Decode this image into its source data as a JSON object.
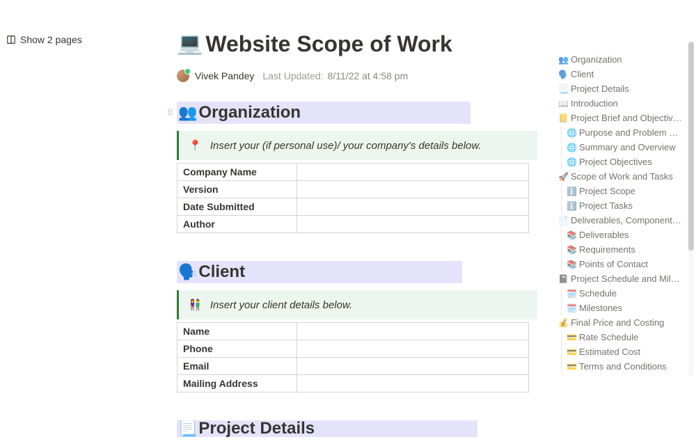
{
  "topbar": {
    "show_pages": "Show 2 pages"
  },
  "page": {
    "title_emoji": "💻",
    "title": "Website Scope of Work",
    "author": "Vivek Pandey",
    "updated_label": "Last Updated:",
    "updated_value": "8/11/22 at 4:58 pm"
  },
  "sections": {
    "org": {
      "emoji": "👥",
      "title": "Organization",
      "callout_icon": "📍",
      "callout": "Insert your (if personal use)/ your company's details below.",
      "rows": [
        "Company Name",
        "Version",
        "Date Submitted",
        "Author"
      ]
    },
    "client": {
      "emoji": "🗣️",
      "title": "Client",
      "callout_icon": "👫",
      "callout": "Insert your client details below.",
      "rows": [
        "Name",
        "Phone",
        "Email",
        "Mailing Address"
      ]
    },
    "project_details": {
      "emoji": "📃",
      "title": "Project Details"
    }
  },
  "outline": [
    {
      "icon": "👥",
      "label": "Organization",
      "indent": 0
    },
    {
      "icon": "🗣️",
      "label": "Client",
      "indent": 0
    },
    {
      "icon": "📃",
      "label": "Project Details",
      "indent": 0
    },
    {
      "icon": "📖",
      "label": "Introduction",
      "indent": 0
    },
    {
      "icon": "📒",
      "label": "Project Brief and Objectives",
      "indent": 0
    },
    {
      "icon": "🌐",
      "label": "Purpose and Problem Statem…",
      "indent": 1
    },
    {
      "icon": "🌐",
      "label": "Summary and Overview",
      "indent": 1
    },
    {
      "icon": "🌐",
      "label": "Project Objectives",
      "indent": 1
    },
    {
      "icon": "🚀",
      "label": "Scope of Work and Tasks",
      "indent": 0
    },
    {
      "icon": "ℹ️",
      "label": " Project Scope",
      "indent": 1
    },
    {
      "icon": "ℹ️",
      "label": " Project Tasks",
      "indent": 1
    },
    {
      "icon": "📄",
      "label": "Deliverables, Components, & R…",
      "indent": 0
    },
    {
      "icon": "📚",
      "label": "Deliverables",
      "indent": 1
    },
    {
      "icon": "📚",
      "label": " Requirements",
      "indent": 1
    },
    {
      "icon": "📚",
      "label": "Points of Contact",
      "indent": 1
    },
    {
      "icon": "📓",
      "label": "Project Schedule and Milestones",
      "indent": 0
    },
    {
      "icon": "🗓️",
      "label": "Schedule",
      "indent": 1
    },
    {
      "icon": "🗓️",
      "label": "Milestones",
      "indent": 1
    },
    {
      "icon": "💰",
      "label": " Final Price and Costing",
      "indent": 0
    },
    {
      "icon": "💳",
      "label": "Rate Schedule",
      "indent": 1
    },
    {
      "icon": "💳",
      "label": "Estimated Cost",
      "indent": 1
    },
    {
      "icon": "💳",
      "label": "Terms and Conditions",
      "indent": 1
    }
  ]
}
